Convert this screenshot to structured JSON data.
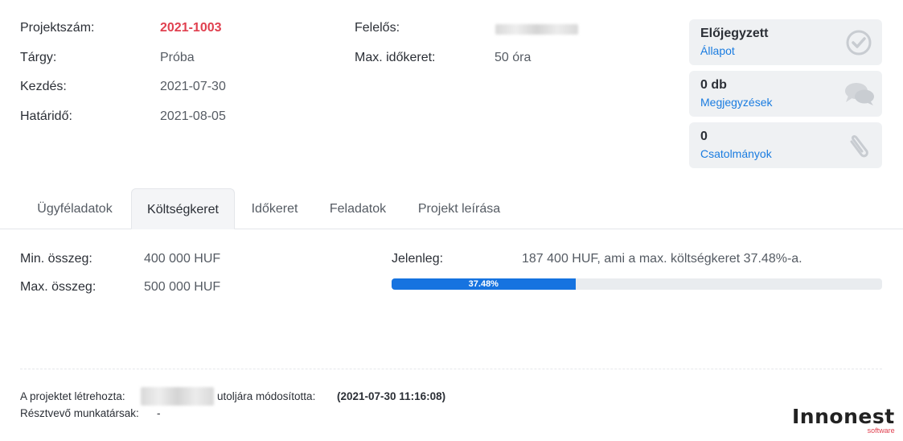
{
  "project": {
    "fields_left": [
      {
        "label": "Projektszám:",
        "value": "2021-1003"
      },
      {
        "label": "Tárgy:",
        "value": "Próba"
      },
      {
        "label": "Kezdés:",
        "value": "2021-07-30"
      },
      {
        "label": "Határidő:",
        "value": "2021-08-05"
      }
    ],
    "fields_mid": [
      {
        "label": "Felelős:",
        "value": ""
      },
      {
        "label": "Max. időkeret:",
        "value": "50 óra"
      }
    ]
  },
  "cards": [
    {
      "value": "Előjegyzett",
      "link": "Állapot",
      "icon": "check-circle-icon"
    },
    {
      "value": "0 db",
      "link": "Megjegyzések",
      "icon": "comments-icon"
    },
    {
      "value": "0",
      "link": "Csatolmányok",
      "icon": "paperclip-icon"
    }
  ],
  "tabs": [
    {
      "label": "Ügyféladatok",
      "active": false
    },
    {
      "label": "Költségkeret",
      "active": true
    },
    {
      "label": "Időkeret",
      "active": false
    },
    {
      "label": "Feladatok",
      "active": false
    },
    {
      "label": "Projekt leírása",
      "active": false
    }
  ],
  "budget": {
    "min_label": "Min. összeg:",
    "min_value": "400 000 HUF",
    "max_label": "Max. összeg:",
    "max_value": "500 000 HUF",
    "current_label": "Jelenleg:",
    "current_value": "187 400 HUF, ami a max. költségkeret 37.48%-a.",
    "progress_percent": 37.48,
    "progress_text": "37.48%"
  },
  "footer": {
    "created_by_label": "A projektet létrehozta:",
    "modified_label": "utoljára módosította:",
    "modified_value": "(2021-07-30 11:16:08)",
    "participants_label": "Résztvevő munkatársak:",
    "participants_value": "-"
  },
  "logo": {
    "main": "Innonest",
    "sub": "software"
  },
  "colors": {
    "accent": "#1673e0",
    "red": "#e0404f",
    "link": "#1a7ce0"
  }
}
